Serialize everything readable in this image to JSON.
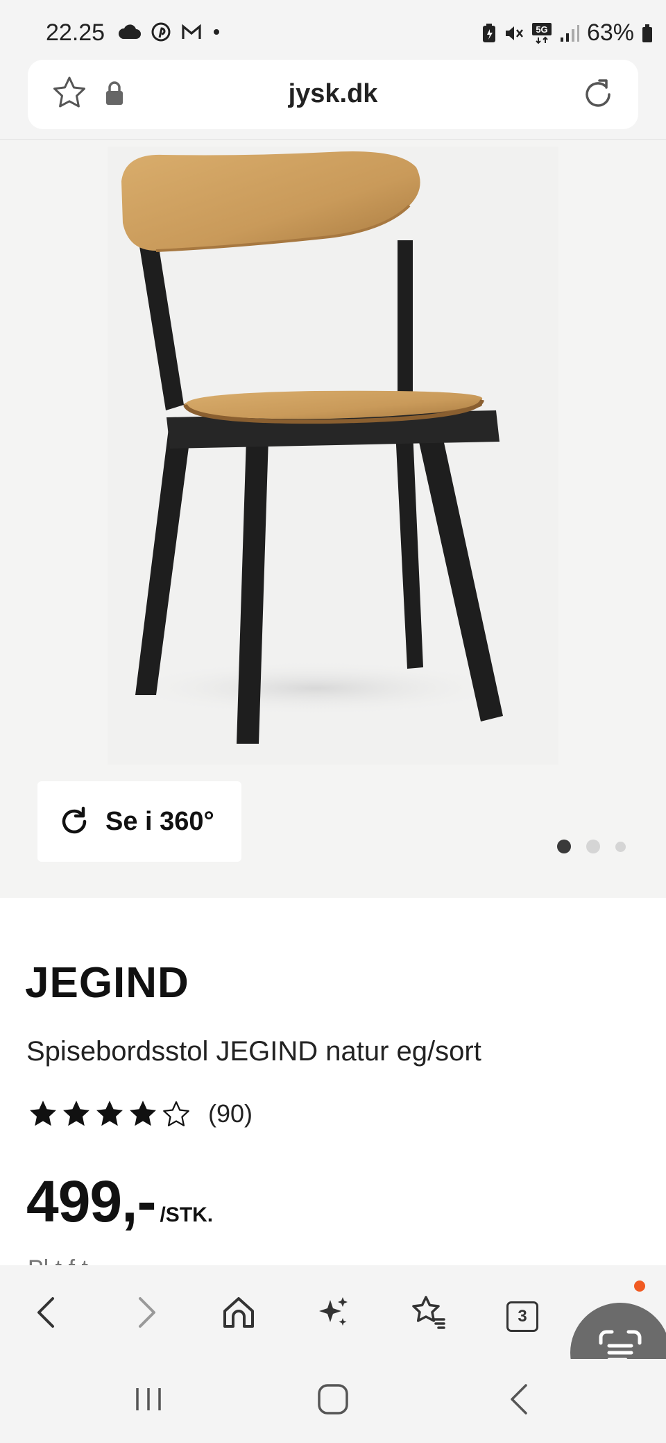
{
  "status_bar": {
    "time": "22.25",
    "left_icons": [
      "cloud-icon",
      "pinterest-icon",
      "gmail-icon",
      "dot-icon"
    ],
    "right_icons": [
      "battery-saver-icon",
      "mute-icon",
      "5g-icon",
      "signal-icon"
    ],
    "battery": "63%"
  },
  "browser": {
    "url": "jysk.dk"
  },
  "gallery": {
    "view360_label": "Se i 360°",
    "image_count": 3,
    "active_index": 0
  },
  "product": {
    "brand": "JEGIND",
    "subtitle": "Spisebordsstol JEGIND natur eg/sort",
    "rating_stars": 4,
    "rating_count": "(90)",
    "price": "499,-",
    "price_unit": "/STK.",
    "cut_text": "Pl       t f   t"
  },
  "toolbar": {
    "tabs_count": "3",
    "items": [
      "back-icon",
      "forward-icon",
      "home-icon",
      "ai-sparkle-icon",
      "bookmarks-icon",
      "tabs-icon",
      "scan-icon"
    ]
  },
  "colors": {
    "accent_notification": "#f05a22",
    "chair_wood": "#c99a5a",
    "chair_frame": "#1e1e1e"
  }
}
